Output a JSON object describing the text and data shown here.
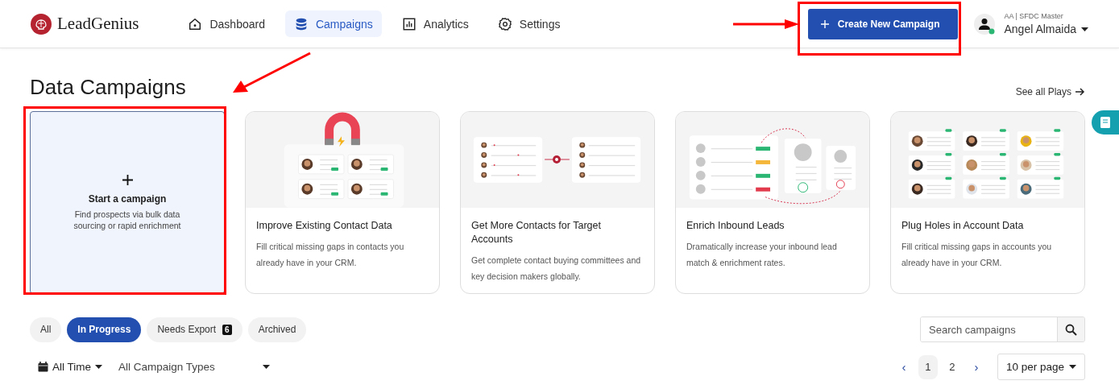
{
  "header": {
    "logo": "LeadGenius",
    "nav": [
      {
        "label": "Dashboard",
        "kind": "home",
        "selected": false
      },
      {
        "label": "Campaigns",
        "kind": "database",
        "selected": true
      },
      {
        "label": "Analytics",
        "kind": "chart",
        "selected": false
      },
      {
        "label": "Settings",
        "kind": "gear",
        "selected": false
      }
    ],
    "create_button": {
      "label": "Create New Campaign",
      "highlighted": true
    },
    "user": {
      "role": "AA | SFDC Master",
      "name": "Angel Almaida",
      "online": true
    }
  },
  "title": "Data Campaigns",
  "see_all": "See all Plays",
  "start_card": {
    "title": "Start a campaign",
    "description": "Find prospects via bulk data sourcing or rapid enrichment",
    "highlighted": true
  },
  "plays": [
    {
      "kind": "magnet",
      "title": "Improve Existing Contact Data",
      "description": "Fill critical missing gaps in contacts you already have in your CRM."
    },
    {
      "kind": "merge",
      "title": "Get More Contacts for Target Accounts",
      "description": "Get complete contact buying committees and key decision makers globally."
    },
    {
      "kind": "inbound",
      "title": "Enrich Inbound Leads",
      "description": "Dramatically increase your inbound lead match & enrichment rates."
    },
    {
      "kind": "grid",
      "title": "Plug Holes in Account Data",
      "description": "Fill critical missing gaps in accounts you already have in your CRM."
    }
  ],
  "filters": [
    {
      "label": "All",
      "selected": false
    },
    {
      "label": "In Progress",
      "selected": true
    },
    {
      "label": "Needs Export",
      "badge": "6",
      "selected": false
    },
    {
      "label": "Archived",
      "selected": false
    }
  ],
  "search": {
    "placeholder": "Search campaigns"
  },
  "time_filter": "All Time",
  "type_filter": "All Campaign Types",
  "pagination": {
    "prev": "‹",
    "pages": [
      {
        "label": "1",
        "selected": true
      },
      {
        "label": "2",
        "selected": false
      }
    ],
    "next": "›",
    "per_page": "10 per page"
  }
}
